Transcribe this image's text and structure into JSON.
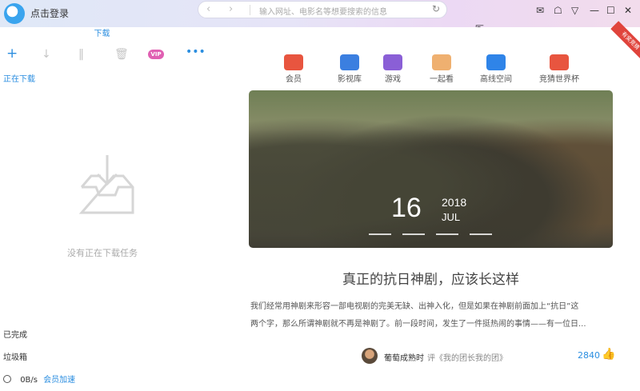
{
  "titlebar": {
    "login": "点击登录",
    "address_placeholder": "输入网址、电影名等想要搜索的信息",
    "back_icon": "chevron-left-icon",
    "forward_icon": "chevron-right-icon",
    "refresh_icon": "refresh-icon"
  },
  "download_panel": {
    "tab_label": "下载",
    "vip_label": "VIP",
    "downloading_label": "正在下载",
    "empty_text": "没有正在下载任务",
    "completed_label": "已完成",
    "trash_label": "垃圾箱",
    "speed": "0B/s",
    "accelerate": "会员加速"
  },
  "badge": "有奖竞猜",
  "categories": [
    {
      "label": "会员",
      "icon": "vip-crown-icon",
      "color": "#e8553f"
    },
    {
      "label": "影视库",
      "icon": "video-icon",
      "color": "#3b7fe0"
    },
    {
      "label": "游戏",
      "icon": "gamepad-icon",
      "color": "#8a5fd6"
    },
    {
      "label": "一起看",
      "icon": "camera-icon",
      "color": "#efb070"
    },
    {
      "label": "高线空间",
      "icon": "cloud-icon",
      "color": "#2f84e8"
    },
    {
      "label": "竞猜世界杯",
      "icon": "gift-icon",
      "color": "#e8553f"
    }
  ],
  "hero": {
    "day": "16",
    "year": "2018",
    "month": "JUL"
  },
  "article": {
    "title": "真正的抗日神剧，应该长这样",
    "body_line1": "我们经常用神剧来形容一部电视剧的完美无缺、出神入化，但是如果在神剧前面加上“抗日”这",
    "body_line2": "两个字，那么所谓神剧就不再是神剧了。前一段时间，发生了一件挺热闹的事情——有一位日...",
    "author": "葡萄成熟时",
    "review": "评《我的团长我的团》",
    "likes": "2840"
  }
}
